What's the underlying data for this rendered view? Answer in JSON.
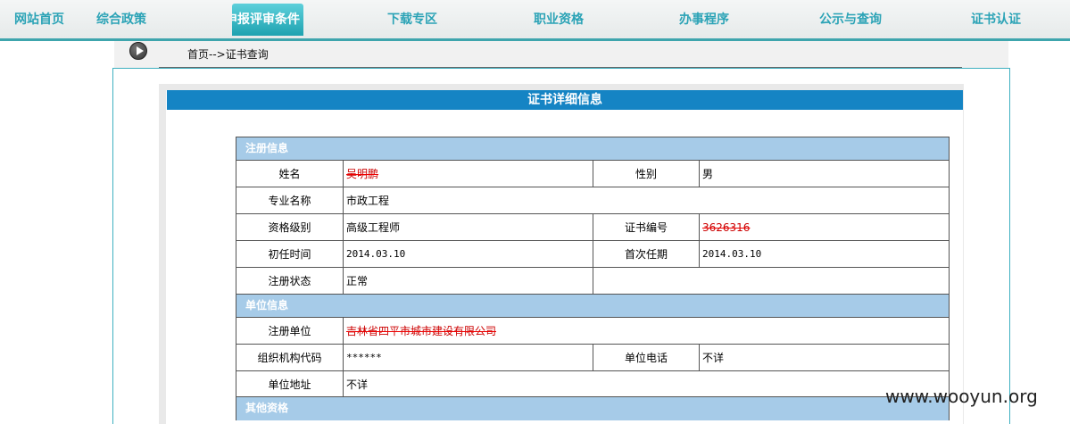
{
  "nav": {
    "items": [
      {
        "label": "网站首页"
      },
      {
        "label": "综合政策"
      },
      {
        "label": "申报评审条件"
      },
      {
        "label": "下载专区"
      },
      {
        "label": "职业资格"
      },
      {
        "label": "办事程序"
      },
      {
        "label": "公示与查询"
      },
      {
        "label": "证书认证"
      }
    ]
  },
  "breadcrumb": {
    "text": "首页-->证书查询"
  },
  "panel": {
    "title": "证书详细信息"
  },
  "sections": {
    "registration": "注册信息",
    "unit": "单位信息",
    "other": "其他资格"
  },
  "fields": {
    "name_label": "姓名",
    "name_value": "吴明鹏",
    "gender_label": "性别",
    "gender_value": "男",
    "major_label": "专业名称",
    "major_value": "市政工程",
    "level_label": "资格级别",
    "level_value": "高级工程师",
    "cert_no_label": "证书编号",
    "cert_no_value": "3626316",
    "first_label": "初任时间",
    "first_value": "2014.03.10",
    "first_term_label": "首次任期",
    "first_term_value": "2014.03.10",
    "status_label": "注册状态",
    "status_value": "正常",
    "unit_label": "注册单位",
    "unit_value": "吉林省四平市城市建设有限公司",
    "org_code_label": "组织机构代码",
    "org_code_value": "******",
    "phone_label": "单位电话",
    "phone_value": "不详",
    "address_label": "单位地址",
    "address_value": "不详"
  },
  "watermark": "www.wooyun.org",
  "colors": {
    "accent": "#2ba3b6",
    "title_bar": "#1584c4",
    "section_bar": "#a6cbe8"
  }
}
